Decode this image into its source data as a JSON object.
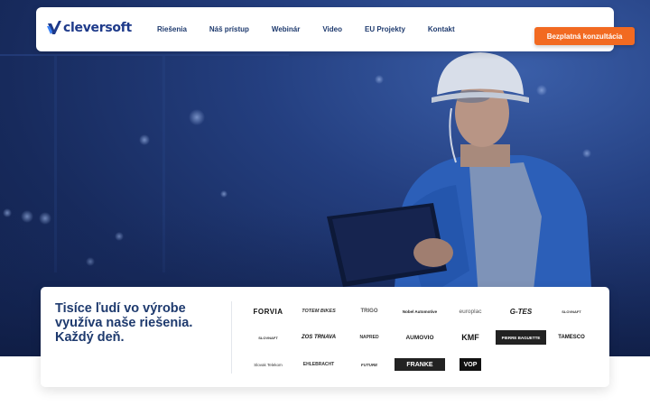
{
  "brand": {
    "name": "cleversoft",
    "color": "#1e3a8a"
  },
  "nav": {
    "links": [
      "Riešenia",
      "Náš prístup",
      "Webinár",
      "Video",
      "EU Projekty",
      "Kontakt"
    ],
    "cta": "Bezplatná konzultácia",
    "cta_color": "#f26a21"
  },
  "hero": {
    "image_subject": "engineer-with-tablet"
  },
  "clients": {
    "tagline": [
      "Tisíce ľudí vo výrobe",
      "využíva naše riešenia.",
      "Každý deň."
    ],
    "logos": [
      [
        "FORVIA",
        "TOTEM BIKES",
        "TRIGO",
        "Nobel Automotive",
        "europlac",
        "G-TES",
        "SLOVNAFT"
      ],
      [
        "SLOVNAFT",
        "ZOS TRNAVA",
        "NAPRED",
        "AUMOVIO",
        "KMF",
        "PIERRE BAGUETTE",
        "TAMESCO"
      ],
      [
        "Slovak Telekom",
        "EHLEBRACHT",
        "FUTURE",
        "FRANKE",
        "VOP"
      ]
    ]
  }
}
